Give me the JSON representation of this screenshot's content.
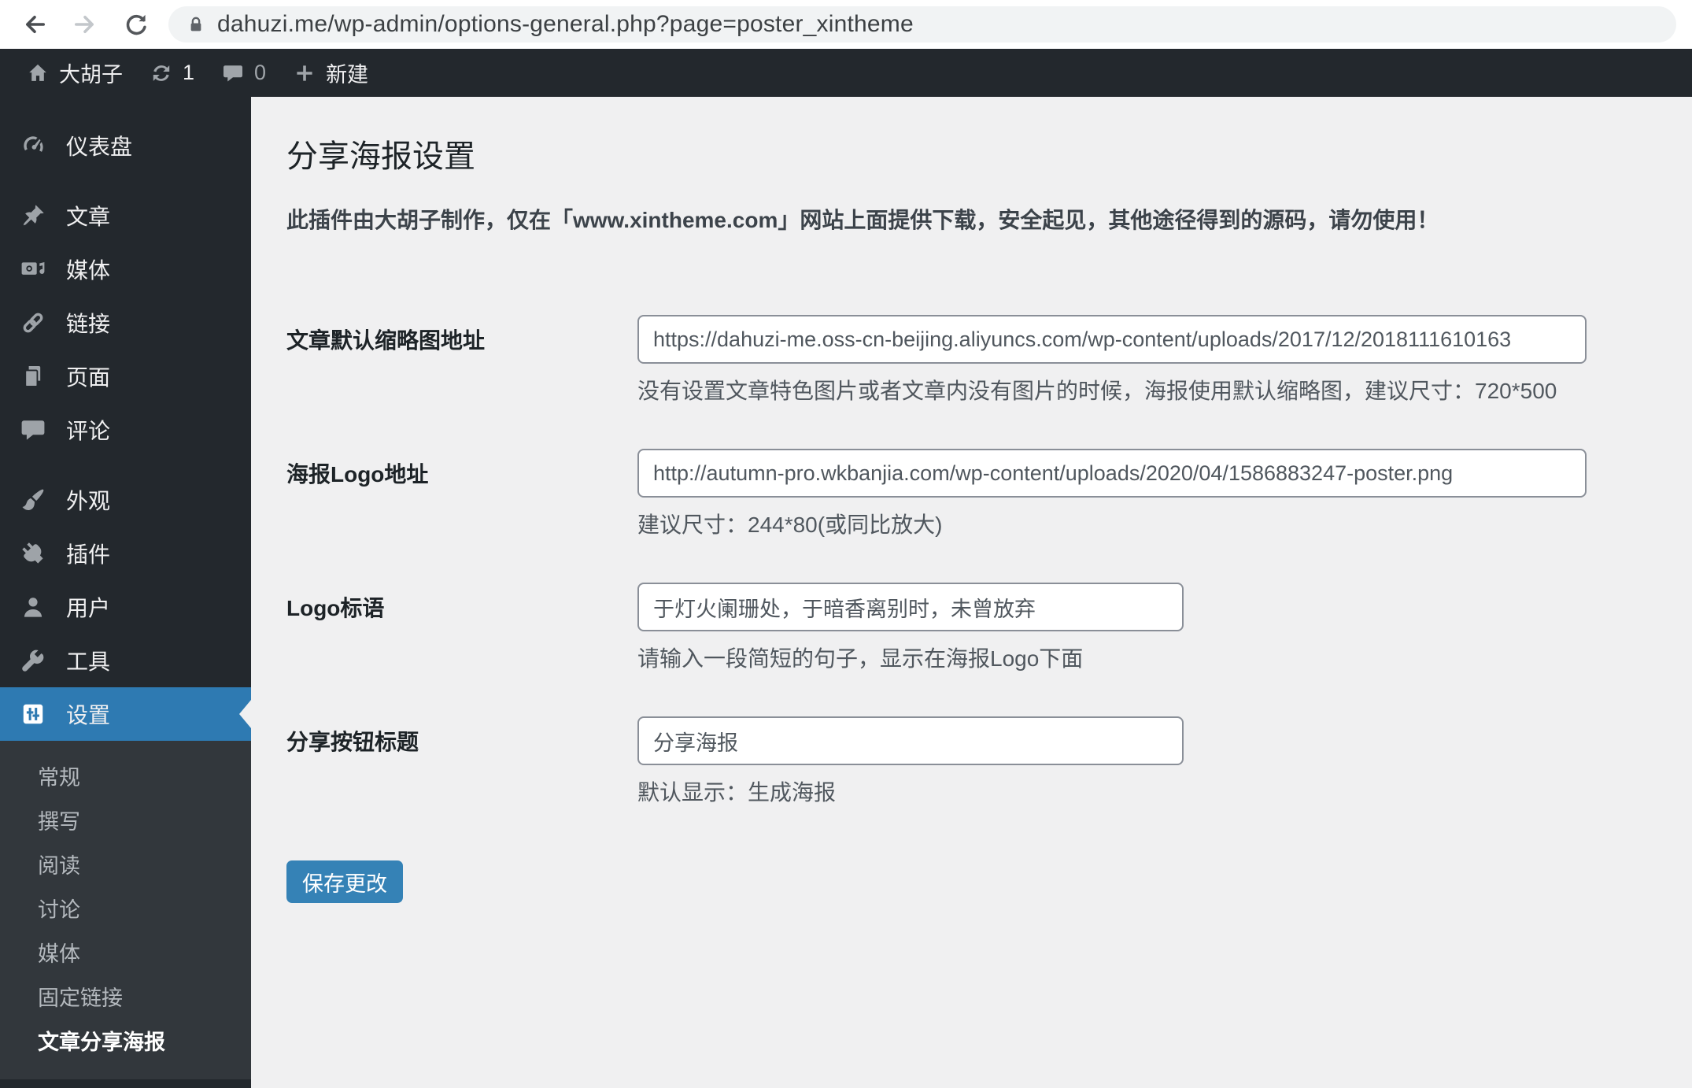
{
  "browser": {
    "url": "dahuzi.me/wp-admin/options-general.php?page=poster_xintheme"
  },
  "admin_bar": {
    "site_name": "大胡子",
    "update_count": "1",
    "comment_count": "0",
    "new_label": "新建"
  },
  "sidebar": {
    "items": [
      {
        "label": "仪表盘"
      },
      {
        "label": "文章"
      },
      {
        "label": "媒体"
      },
      {
        "label": "链接"
      },
      {
        "label": "页面"
      },
      {
        "label": "评论"
      },
      {
        "label": "外观"
      },
      {
        "label": "插件"
      },
      {
        "label": "用户"
      },
      {
        "label": "工具"
      },
      {
        "label": "设置"
      }
    ],
    "submenu": [
      "常规",
      "撰写",
      "阅读",
      "讨论",
      "媒体",
      "固定链接",
      "文章分享海报"
    ]
  },
  "main": {
    "title": "分享海报设置",
    "notice": "此插件由大胡子制作，仅在「www.xintheme.com」网站上面提供下载，安全起见，其他途径得到的源码，请勿使用！",
    "fields": [
      {
        "label": "文章默认缩略图地址",
        "value": "https://dahuzi-me.oss-cn-beijing.aliyuncs.com/wp-content/uploads/2017/12/2018111610163",
        "help": "没有设置文章特色图片或者文章内没有图片的时候，海报使用默认缩略图，建议尺寸：720*500"
      },
      {
        "label": "海报Logo地址",
        "value": "http://autumn-pro.wkbanjia.com/wp-content/uploads/2020/04/1586883247-poster.png",
        "help": "建议尺寸：244*80(或同比放大)"
      },
      {
        "label": "Logo标语",
        "value": "于灯火阑珊处，于暗香离别时，未曾放弃",
        "help": "请输入一段简短的句子，显示在海报Logo下面"
      },
      {
        "label": "分享按钮标题",
        "value": "分享海报",
        "help": "默认显示：生成海报"
      }
    ],
    "save_label": "保存更改"
  },
  "icons": {
    "browser": [
      "back-icon",
      "forward-icon",
      "reload-icon",
      "lock-icon"
    ],
    "admin_bar": [
      "home-icon",
      "update-icon",
      "comment-icon",
      "plus-icon"
    ],
    "sidebar": [
      "dashboard-gauge-icon",
      "pushpin-icon",
      "media-camera-icon",
      "chain-link-icon",
      "pages-icon",
      "comment-bubble-icon",
      "paintbrush-icon",
      "plug-icon",
      "user-icon",
      "wrench-icon",
      "settings-sliders-icon"
    ]
  },
  "colors": {
    "accent_blue": "#2e7ab2",
    "button_blue": "#3582b6",
    "admin_bar_bg": "#23282d",
    "submenu_bg": "#32373c",
    "content_bg": "#f0f0f1"
  }
}
